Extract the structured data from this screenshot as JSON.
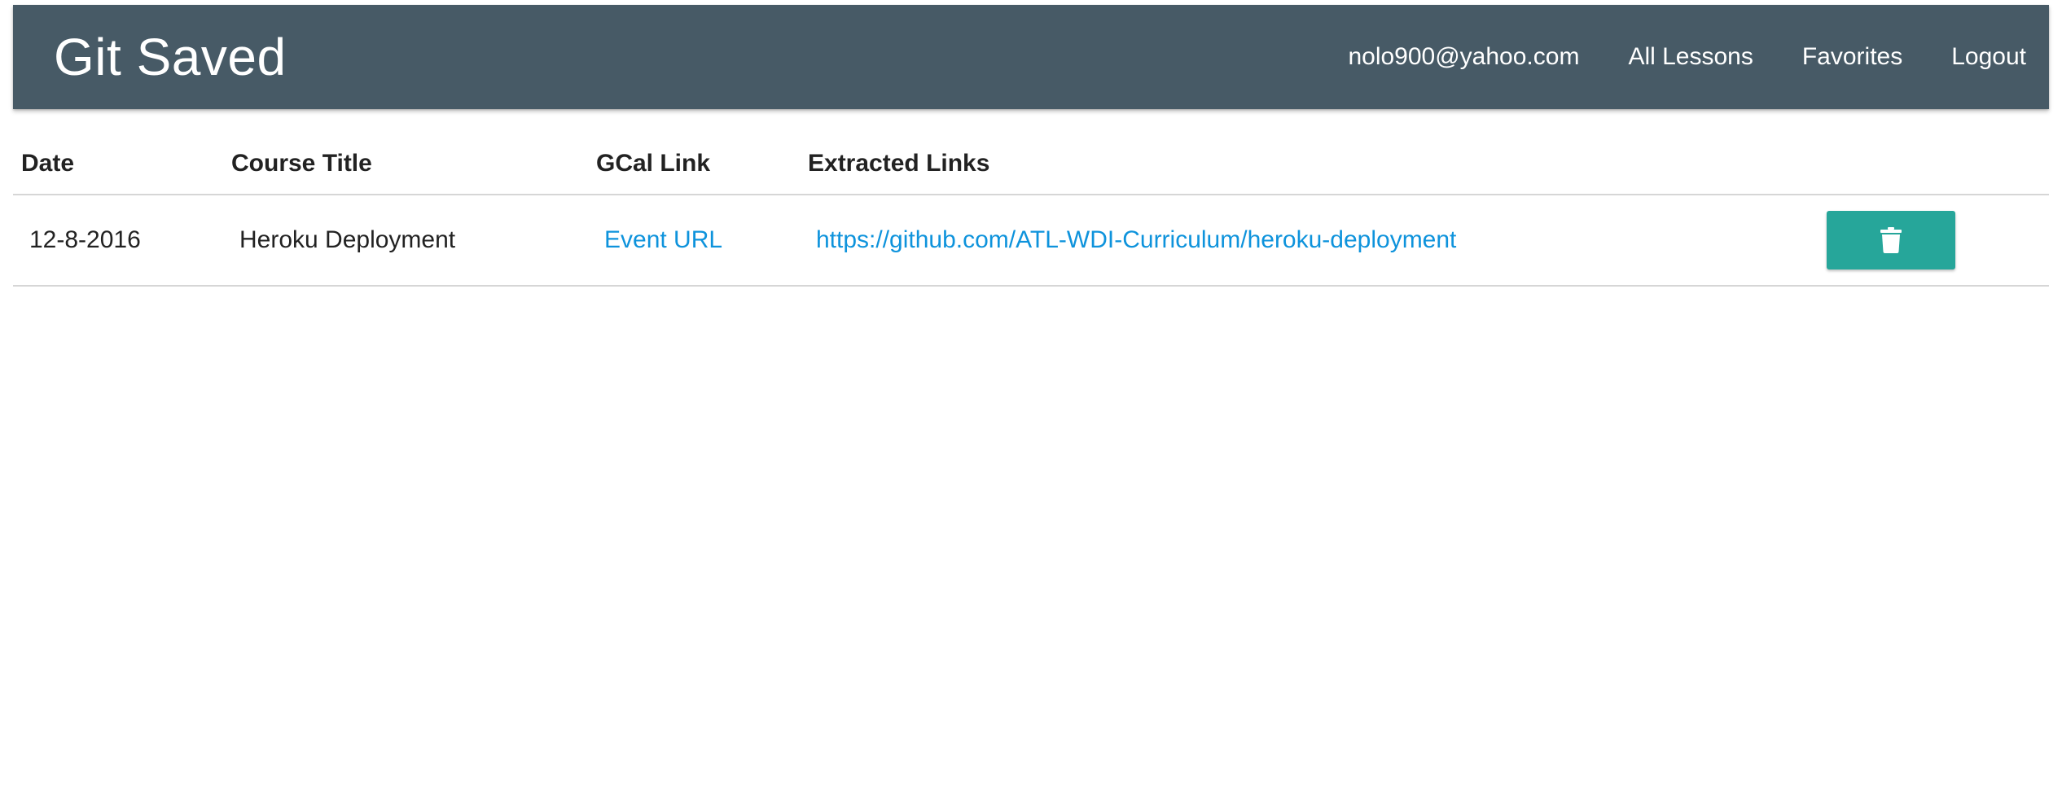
{
  "navbar": {
    "brand": "Git Saved",
    "links": [
      "nolo900@yahoo.com",
      "All Lessons",
      "Favorites",
      "Logout"
    ],
    "background_color": "#475a66"
  },
  "table": {
    "headers": [
      "Date",
      "Course Title",
      "GCal Link",
      "Extracted Links",
      ""
    ],
    "rows": [
      {
        "date": "12-8-2016",
        "course_title": "Heroku Deployment",
        "gcal_link_label": "Event URL",
        "extracted_link": "https://github.com/ATL-WDI-Curriculum/heroku-deployment",
        "action_icon": "trash-icon"
      }
    ]
  },
  "colors": {
    "link": "#0e93dc",
    "delete_button": "#26a69a"
  }
}
